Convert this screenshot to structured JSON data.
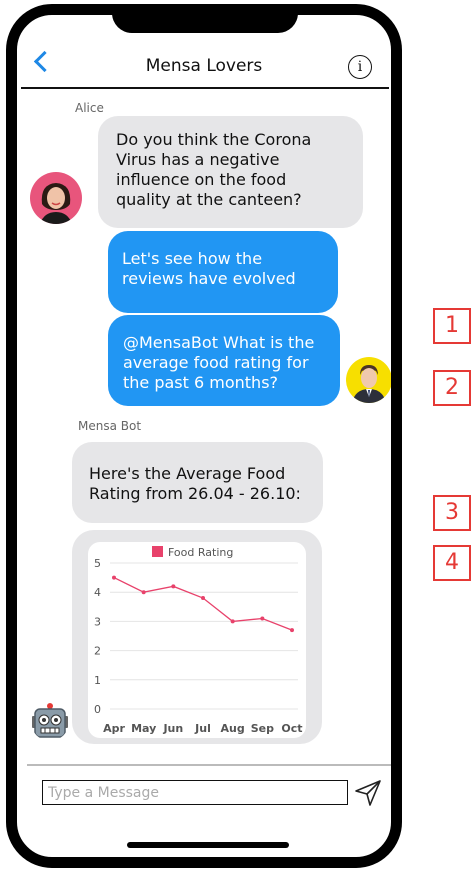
{
  "header": {
    "title": "Mensa Lovers",
    "info_glyph": "i"
  },
  "messages": [
    {
      "sender": "Alice",
      "text": "Do you think the Corona Virus has a negative influence on the food quality at the canteen?"
    },
    {
      "text": "Let's see how the reviews have evolved"
    },
    {
      "text": "@MensaBot What is the average food rating for the past 6 months?"
    },
    {
      "sender": "Mensa Bot",
      "text": "Here's the Average Food Rating from 26.04 - 26.10:"
    }
  ],
  "chart_data": {
    "type": "line",
    "categories": [
      "Apr",
      "May",
      "Jun",
      "Jul",
      "Aug",
      "Sep",
      "Oct"
    ],
    "series": [
      {
        "name": "Food Rating",
        "values": [
          4.5,
          4.0,
          4.2,
          3.8,
          3.0,
          3.1,
          2.7
        ]
      }
    ],
    "ylim": [
      0,
      5
    ],
    "yticks": [
      "0",
      "1",
      "2",
      "3",
      "4",
      "5"
    ],
    "legend": "top",
    "grid": true,
    "color": "#e8426b"
  },
  "composer": {
    "placeholder": "Type a Message"
  },
  "markers": [
    "1",
    "2",
    "3",
    "4"
  ],
  "colors": {
    "accent": "#2196f3",
    "incoming": "#e6e6e8",
    "marker": "#e53935"
  }
}
